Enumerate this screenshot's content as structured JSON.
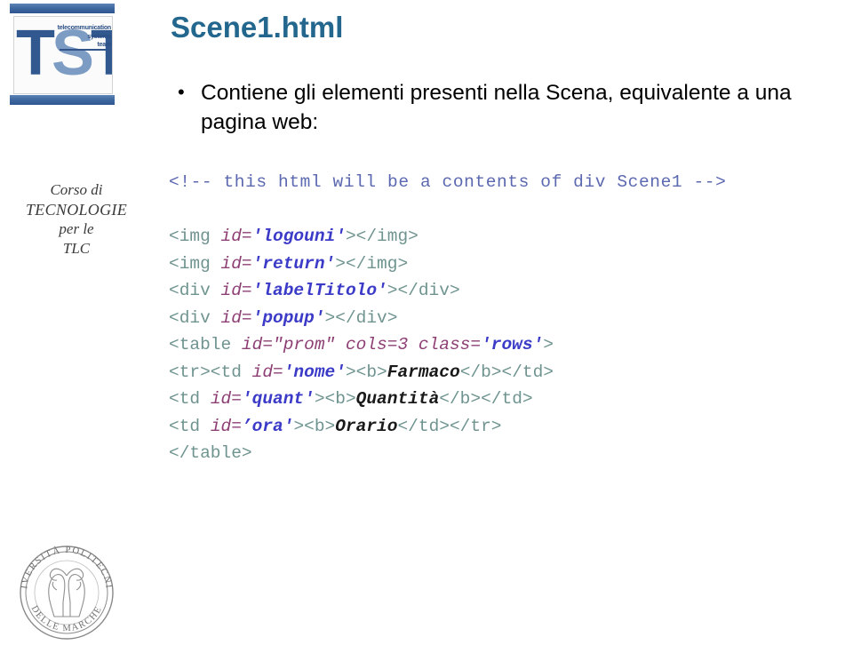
{
  "slide": {
    "title": "Scene1.html",
    "bullet": {
      "marker": "•",
      "text": "Contiene gli elementi presenti nella Scena, equivalente a una pagina web:"
    }
  },
  "branding": {
    "tst_logo": {
      "letters_t1": "T",
      "letters_s": "S",
      "letters_t2": "T",
      "word1": "telecommunication",
      "word2": "systems",
      "word3": "team"
    },
    "course": {
      "line1": "Corso di",
      "line2": "TECNOLOGIE",
      "line3": "per le",
      "line4": "TLC"
    },
    "seal": {
      "top_text": "UNIVERSITÀ POLITECNICA",
      "bottom_text": "DELLE MARCHE"
    }
  },
  "code": {
    "lines": [
      {
        "id": "comment",
        "tokens": [
          {
            "cls": "t-comment",
            "text": "<!-- this html will be a contents of div Scene1 -->"
          }
        ]
      },
      {
        "id": "blank",
        "tokens": []
      },
      {
        "id": "img-logouni",
        "tokens": [
          {
            "cls": "t-tag",
            "text": "<img "
          },
          {
            "cls": "t-attr",
            "text": "id="
          },
          {
            "cls": "t-val",
            "text": "'logouni'"
          },
          {
            "cls": "t-tag",
            "text": "></img>"
          }
        ]
      },
      {
        "id": "img-return",
        "tokens": [
          {
            "cls": "t-tag",
            "text": "<img "
          },
          {
            "cls": "t-attr",
            "text": "id="
          },
          {
            "cls": "t-val",
            "text": "'return'"
          },
          {
            "cls": "t-tag",
            "text": "></img>"
          }
        ]
      },
      {
        "id": "div-labeltitolo",
        "tokens": [
          {
            "cls": "t-tag",
            "text": "<div "
          },
          {
            "cls": "t-attr",
            "text": "id="
          },
          {
            "cls": "t-val",
            "text": "'labelTitolo'"
          },
          {
            "cls": "t-tag",
            "text": "></div>"
          }
        ]
      },
      {
        "id": "div-popup",
        "tokens": [
          {
            "cls": "t-tag",
            "text": "<div "
          },
          {
            "cls": "t-attr",
            "text": "id="
          },
          {
            "cls": "t-val",
            "text": "'popup'"
          },
          {
            "cls": "t-tag",
            "text": "></div>"
          }
        ]
      },
      {
        "id": "table-prom",
        "tokens": [
          {
            "cls": "t-tag",
            "text": "<table "
          },
          {
            "cls": "t-attr",
            "text": "id="
          },
          {
            "cls": "t-attr",
            "text": "\"prom\""
          },
          {
            "cls": "t-attr",
            "text": " cols=3 class="
          },
          {
            "cls": "t-val",
            "text": "'rows'"
          },
          {
            "cls": "t-tag",
            "text": ">"
          }
        ]
      },
      {
        "id": "td-nome",
        "tokens": [
          {
            "cls": "t-tag",
            "text": "<tr><td "
          },
          {
            "cls": "t-attr",
            "text": "id="
          },
          {
            "cls": "t-val",
            "text": "'nome'"
          },
          {
            "cls": "t-tag",
            "text": "><b>"
          },
          {
            "cls": "t-txt",
            "text": "Farmaco"
          },
          {
            "cls": "t-tag",
            "text": "</b></td>"
          }
        ]
      },
      {
        "id": "td-quant",
        "tokens": [
          {
            "cls": "t-tag",
            "text": "<td "
          },
          {
            "cls": "t-attr",
            "text": "id="
          },
          {
            "cls": "t-val",
            "text": "'quant'"
          },
          {
            "cls": "t-tag",
            "text": "><b>"
          },
          {
            "cls": "t-txt",
            "text": "Quantità"
          },
          {
            "cls": "t-tag",
            "text": "</b></td>"
          }
        ]
      },
      {
        "id": "td-ora",
        "tokens": [
          {
            "cls": "t-tag",
            "text": "<td "
          },
          {
            "cls": "t-attr",
            "text": "id="
          },
          {
            "cls": "t-val",
            "text": "’ora'"
          },
          {
            "cls": "t-tag",
            "text": "><b>"
          },
          {
            "cls": "t-txt",
            "text": "Orario"
          },
          {
            "cls": "t-tag",
            "text": "</td></tr>"
          }
        ]
      },
      {
        "id": "table-close",
        "tokens": [
          {
            "cls": "t-tag",
            "text": "</table>"
          }
        ]
      }
    ]
  },
  "colors": {
    "title": "#24678e",
    "logo_blue": "#31588f",
    "logo_bar": "#3f69a0",
    "comment": "#5c68b0",
    "tag": "#6f9490",
    "attr": "#8d3f74",
    "value": "#3b3bc8"
  }
}
